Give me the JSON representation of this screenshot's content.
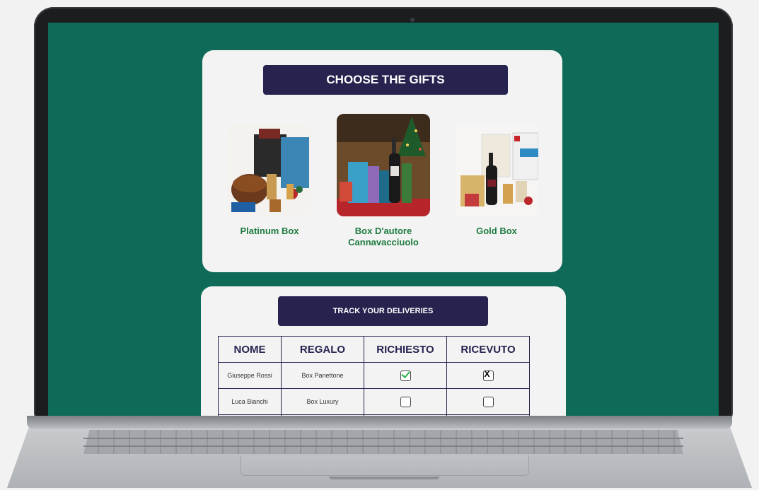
{
  "gifts": {
    "title": "CHOOSE THE GIFTS",
    "items": [
      {
        "name": "Platinum Box"
      },
      {
        "name_line1": "Box D'autore",
        "name_line2": "Cannavacciuolo"
      },
      {
        "name": "Gold Box"
      }
    ]
  },
  "tracking": {
    "title": "TRACK YOUR DELIVERIES",
    "columns": [
      "NOME",
      "REGALO",
      "RICHIESTO",
      "RICEVUTO"
    ],
    "rows": [
      {
        "nome": "Giuseppe Rossi",
        "regalo": "Box Panettone",
        "richiesto": "checked",
        "ricevuto": "x"
      },
      {
        "nome": "Luca Bianchi",
        "regalo": "Box Luxury",
        "richiesto": "empty",
        "ricevuto": "empty"
      }
    ],
    "x_mark": "X"
  },
  "colors": {
    "screen_bg": "#0f6b57",
    "card_bg": "#f3f3f3",
    "navy": "#26244f",
    "gift_text": "#1e7b40",
    "check_green": "#2db34a"
  }
}
